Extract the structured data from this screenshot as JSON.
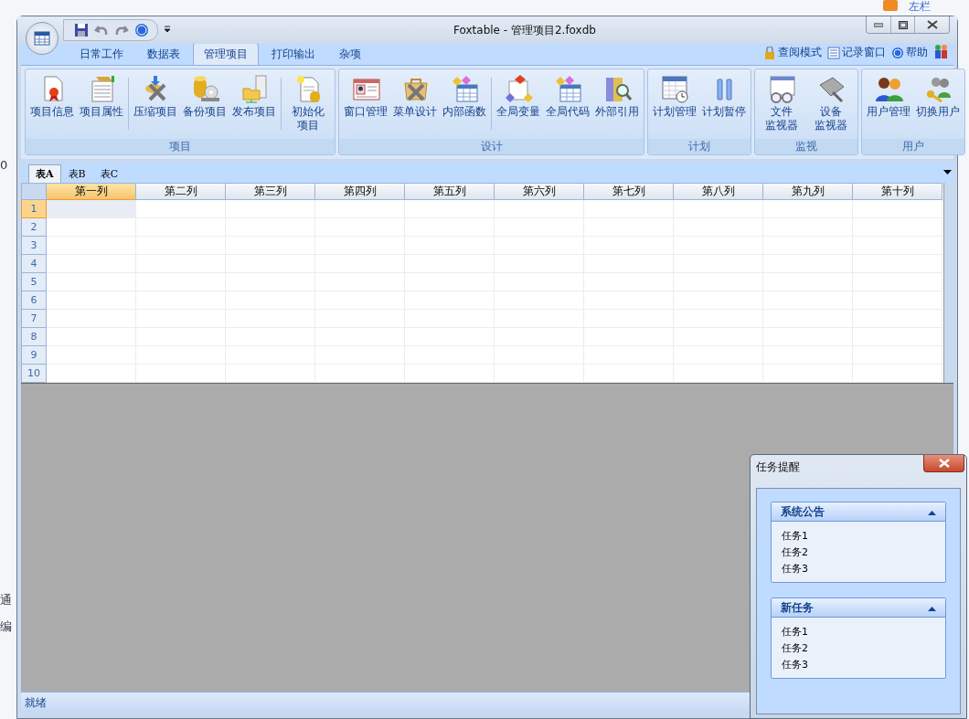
{
  "background": {
    "fragments": [
      "0",
      "通",
      "编"
    ],
    "top_link": "左栏"
  },
  "window": {
    "title": "Foxtable - 管理项目2.foxdb"
  },
  "ribbon_tabs": [
    {
      "label": "日常工作",
      "selected": false
    },
    {
      "label": "数据表",
      "selected": false
    },
    {
      "label": "管理项目",
      "selected": true
    },
    {
      "label": "打印输出",
      "selected": false
    },
    {
      "label": "杂项",
      "selected": false
    }
  ],
  "ribbon_links": [
    "查阅模式",
    "记录窗口",
    "帮助"
  ],
  "ribbon_groups": [
    {
      "label": "项目",
      "buttons": [
        {
          "label": "项目信息",
          "separated": false
        },
        {
          "label": "项目属性",
          "separated": false
        },
        {
          "label": "压缩项目",
          "separated": true
        },
        {
          "label": "备份项目",
          "separated": false
        },
        {
          "label": "发布项目",
          "separated": false
        },
        {
          "label_lines": [
            "初始化",
            "项目"
          ],
          "separated": true
        }
      ]
    },
    {
      "label": "设计",
      "buttons": [
        {
          "label": "窗口管理",
          "separated": false
        },
        {
          "label": "菜单设计",
          "separated": false
        },
        {
          "label": "内部函数",
          "separated": false
        },
        {
          "label": "全局变量",
          "separated": true
        },
        {
          "label": "全局代码",
          "separated": false
        },
        {
          "label": "外部引用",
          "separated": false
        }
      ]
    },
    {
      "label": "计划",
      "buttons": [
        {
          "label": "计划管理",
          "separated": false
        },
        {
          "label": "计划暂停",
          "separated": false
        }
      ]
    },
    {
      "label": "监视",
      "buttons": [
        {
          "label_lines": [
            "文件",
            "监视器"
          ],
          "separated": false
        },
        {
          "label_lines": [
            "设备",
            "监视器"
          ],
          "separated": false
        }
      ]
    },
    {
      "label": "用户",
      "buttons": [
        {
          "label": "用户管理",
          "separated": false
        },
        {
          "label": "切换用户",
          "separated": false
        }
      ]
    }
  ],
  "sheet_tabs": [
    {
      "label": "表A",
      "selected": true
    },
    {
      "label": "表B",
      "selected": false
    },
    {
      "label": "表C",
      "selected": false
    }
  ],
  "table": {
    "columns": [
      {
        "label": "第一列",
        "selected": true
      },
      {
        "label": "第二列",
        "selected": false
      },
      {
        "label": "第三列",
        "selected": false
      },
      {
        "label": "第四列",
        "selected": false
      },
      {
        "label": "第五列",
        "selected": false
      },
      {
        "label": "第六列",
        "selected": false
      },
      {
        "label": "第七列",
        "selected": false
      },
      {
        "label": "第八列",
        "selected": false
      },
      {
        "label": "第九列",
        "selected": false
      },
      {
        "label": "第十列",
        "selected": false
      }
    ],
    "rows": [
      {
        "label": "1",
        "selected": true
      },
      {
        "label": "2",
        "selected": false
      },
      {
        "label": "3",
        "selected": false
      },
      {
        "label": "4",
        "selected": false
      },
      {
        "label": "5",
        "selected": false
      },
      {
        "label": "6",
        "selected": false
      },
      {
        "label": "7",
        "selected": false
      },
      {
        "label": "8",
        "selected": false
      },
      {
        "label": "9",
        "selected": false
      },
      {
        "label": "10",
        "selected": false
      }
    ]
  },
  "status_bar": {
    "text": "就绪"
  },
  "task_popup": {
    "title": "任务提醒",
    "sections": [
      {
        "title": "系统公告",
        "expanded": true,
        "items": [
          "任务1",
          "任务2",
          "任务3"
        ]
      },
      {
        "title": "新任务",
        "expanded": true,
        "items": [
          "任务1",
          "任务2",
          "任务3"
        ]
      }
    ]
  }
}
